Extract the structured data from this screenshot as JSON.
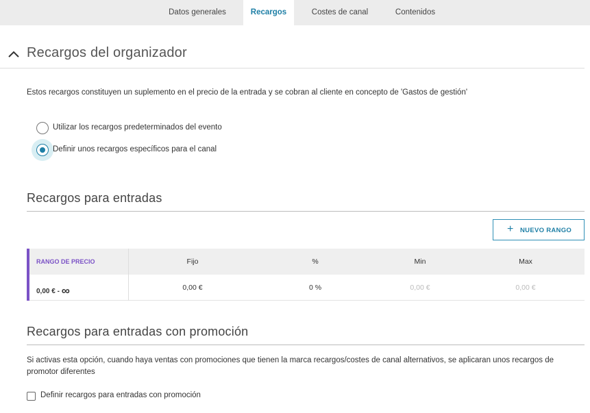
{
  "tabs": [
    {
      "label": "Datos generales",
      "active": false
    },
    {
      "label": "Recargos",
      "active": true
    },
    {
      "label": "Costes de canal",
      "active": false
    },
    {
      "label": "Contenidos",
      "active": false
    }
  ],
  "section": {
    "title": "Recargos del organizador",
    "expanded": true,
    "description": "Estos recargos constituyen un suplemento en el precio de la entrada y se cobran al cliente en concepto de 'Gastos de gestión'",
    "options": [
      {
        "label": "Utilizar los recargos predeterminados del evento",
        "selected": false
      },
      {
        "label": "Definir unos recargos específicos para el canal",
        "selected": true
      }
    ]
  },
  "tickets": {
    "title": "Recargos para entradas",
    "new_range_label": "NUEVO RANGO",
    "table": {
      "headers": [
        "RANGO DE PRECIO",
        "Fijo",
        "%",
        "Min",
        "Max"
      ],
      "rows": [
        {
          "range": "0,00 € - ",
          "infinity": "∞",
          "fixed": "0,00 €",
          "percent": "0 %",
          "min": "0,00 €",
          "max": "0,00 €"
        }
      ]
    }
  },
  "promo": {
    "title": "Recargos para entradas con promoción",
    "description": "Si activas esta opción, cuando haya ventas con promociones que tienen la marca recargos/costes de canal alternativos, se aplicaran unos recargos de promotor diferentes",
    "checkbox_label": "Definir recargos para entradas con promoción",
    "checked": false
  },
  "colors": {
    "accent": "#1e7fa6",
    "table_accent": "#7b52c6"
  }
}
